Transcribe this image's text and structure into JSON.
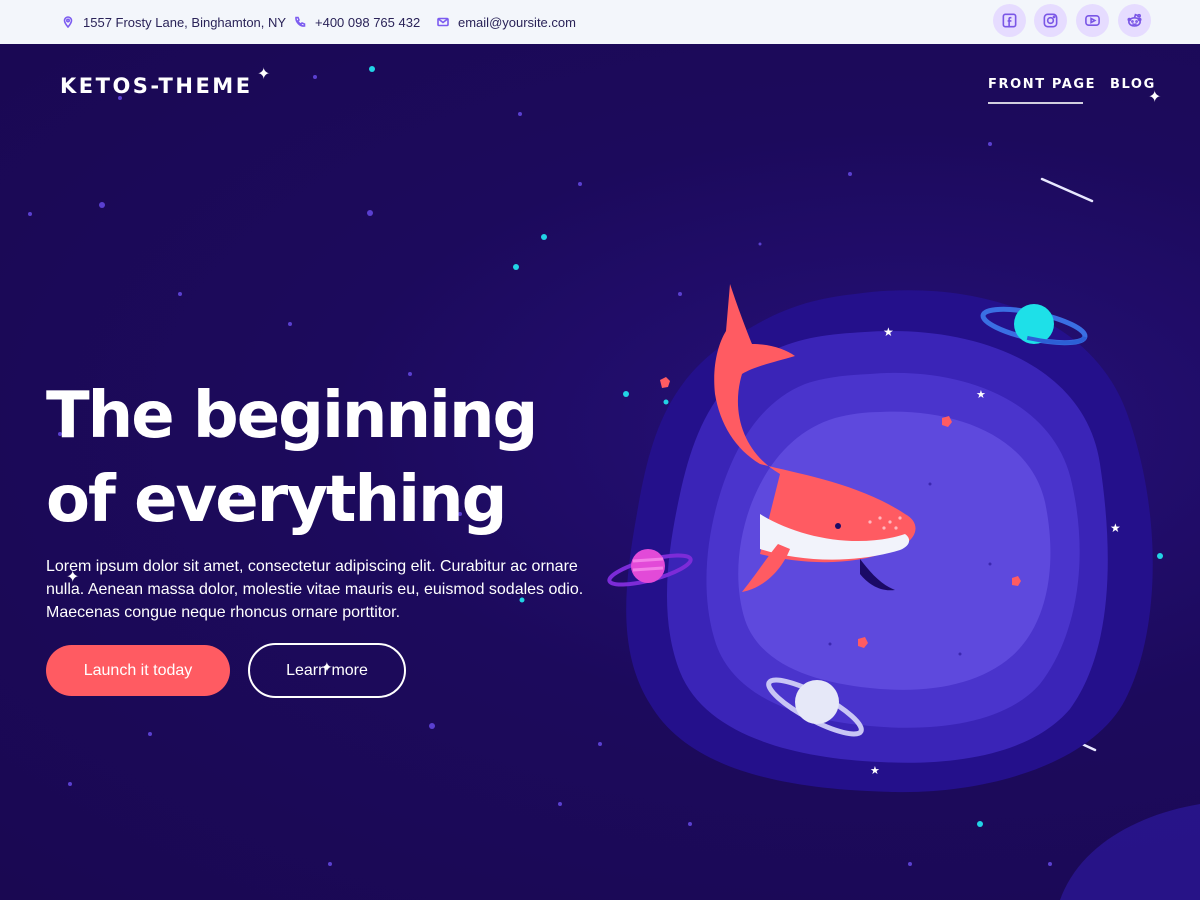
{
  "topbar": {
    "address": "1557 Frosty Lane, Binghamton, NY",
    "phone": "+400 098 765 432",
    "email": "email@yoursite.com",
    "social": [
      "facebook-icon",
      "instagram-icon",
      "youtube-icon",
      "reddit-icon"
    ]
  },
  "header": {
    "logo": "KETOS-THEME",
    "nav": [
      "FRONT PAGE",
      "BLOG"
    ]
  },
  "hero": {
    "headline_line1": "The beginning",
    "headline_line2": "of everything",
    "text": "Lorem ipsum dolor sit amet, consectetur adipiscing elit. Curabitur ac ornare nulla. Aenean massa dolor, molestie vitae mauris eu, euismod sodales odio. Maecenas congue neque rhoncus ornare porttitor.",
    "primary_button": "Launch it today",
    "secondary_button": "Learn more"
  },
  "colors": {
    "background": "#1b0856",
    "accent": "#ff5b62",
    "topbar": "#f3f6fb",
    "icon_circle": "#e6dcff"
  }
}
